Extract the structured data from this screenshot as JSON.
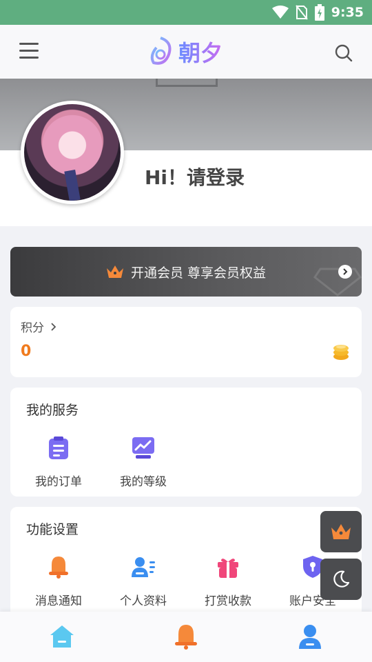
{
  "status_bar": {
    "time": "9:35",
    "icons": [
      "wifi-icon",
      "no-sim-icon",
      "battery-charging-icon"
    ]
  },
  "header": {
    "logo_text": "朝夕",
    "menu_icon": "menu-icon",
    "search_icon": "search-icon"
  },
  "profile": {
    "greeting": "Hi！请登录"
  },
  "vip": {
    "label": "开通会员 尊享会员权益"
  },
  "points": {
    "label": "积分",
    "value": "0"
  },
  "services": {
    "title": "我的服务",
    "items": [
      {
        "label": "我的订单",
        "icon": "clipboard-icon"
      },
      {
        "label": "我的等级",
        "icon": "chart-monitor-icon"
      }
    ]
  },
  "settings": {
    "title": "功能设置",
    "items": [
      {
        "label": "消息通知",
        "icon": "bell-icon"
      },
      {
        "label": "个人资料",
        "icon": "profile-card-icon"
      },
      {
        "label": "打赏收款",
        "icon": "gift-icon"
      },
      {
        "label": "账户安全",
        "icon": "shield-icon"
      }
    ]
  },
  "tabbar": {
    "items": [
      "home-icon",
      "notification-icon",
      "user-icon"
    ]
  },
  "colors": {
    "status_bar": "#5fae80",
    "accent_orange": "#f07b1e",
    "vip_bg": "#3b3b3d",
    "service_purple": "#7b6cf2"
  }
}
